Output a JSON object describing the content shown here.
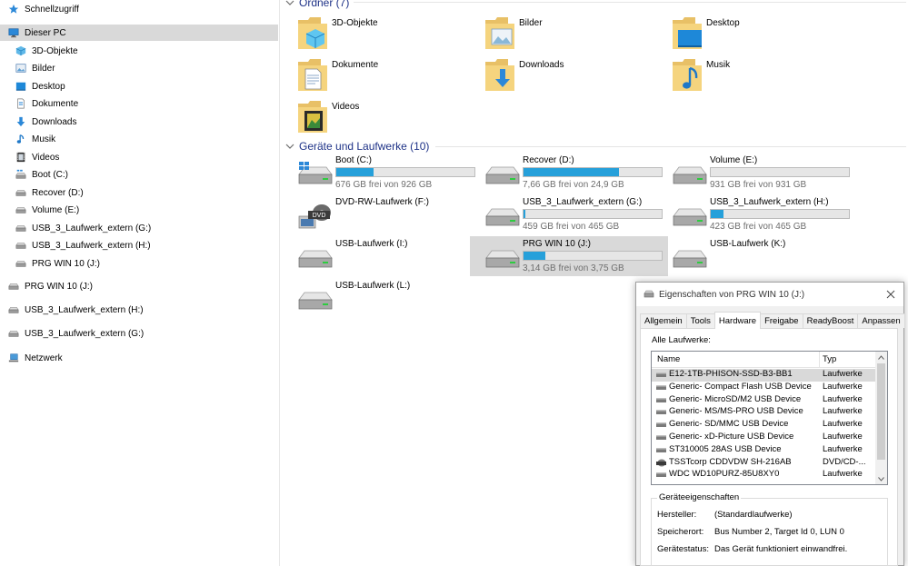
{
  "sidebar": {
    "items": [
      {
        "label": "Schnellzugriff",
        "icon": "star-icon"
      },
      {
        "label": "Dieser PC",
        "icon": "computer-icon"
      },
      {
        "label": "3D-Objekte",
        "icon": "3d-objects-icon"
      },
      {
        "label": "Bilder",
        "icon": "pictures-icon"
      },
      {
        "label": "Desktop",
        "icon": "desktop-icon"
      },
      {
        "label": "Dokumente",
        "icon": "documents-icon"
      },
      {
        "label": "Downloads",
        "icon": "downloads-icon"
      },
      {
        "label": "Musik",
        "icon": "music-icon"
      },
      {
        "label": "Videos",
        "icon": "videos-icon"
      },
      {
        "label": "Boot (C:)",
        "icon": "windows-drive-icon"
      },
      {
        "label": "Recover (D:)",
        "icon": "drive-icon"
      },
      {
        "label": "Volume (E:)",
        "icon": "drive-icon"
      },
      {
        "label": "USB_3_Laufwerk_extern (G:)",
        "icon": "drive-icon"
      },
      {
        "label": "USB_3_Laufwerk_extern  (H:)",
        "icon": "drive-icon"
      },
      {
        "label": "PRG WIN 10 (J:)",
        "icon": "drive-icon"
      },
      {
        "label": "PRG WIN 10 (J:)",
        "icon": "drive-icon"
      },
      {
        "label": "USB_3_Laufwerk_extern  (H:)",
        "icon": "drive-icon"
      },
      {
        "label": "USB_3_Laufwerk_extern (G:)",
        "icon": "drive-icon"
      },
      {
        "label": "Netzwerk",
        "icon": "network-icon"
      }
    ]
  },
  "main": {
    "folders_header": "Ordner (7)",
    "folders": [
      {
        "label": "3D-Objekte",
        "icon": "3d-objects-folder-icon"
      },
      {
        "label": "Bilder",
        "icon": "pictures-folder-icon"
      },
      {
        "label": "Desktop",
        "icon": "desktop-folder-icon"
      },
      {
        "label": "Dokumente",
        "icon": "documents-folder-icon"
      },
      {
        "label": "Downloads",
        "icon": "downloads-folder-icon"
      },
      {
        "label": "Musik",
        "icon": "music-folder-icon"
      },
      {
        "label": "Videos",
        "icon": "videos-folder-icon"
      }
    ],
    "drives_header": "Geräte und Laufwerke (10)",
    "drives": [
      {
        "name": "Boot (C:)",
        "free": "676 GB frei von 926 GB",
        "used_fraction": 0.27,
        "icon": "windows-drive-icon"
      },
      {
        "name": "Recover (D:)",
        "free": "7,66 GB frei von 24,9 GB",
        "used_fraction": 0.69,
        "icon": "drive-icon"
      },
      {
        "name": "Volume (E:)",
        "free": "931 GB frei von 931 GB",
        "used_fraction": 0.0,
        "icon": "drive-icon"
      },
      {
        "name": "DVD-RW-Laufwerk (F:)",
        "free": "",
        "used_fraction": null,
        "icon": "dvd-drive-icon"
      },
      {
        "name": "USB_3_Laufwerk_extern (G:)",
        "free": "459 GB frei von 465 GB",
        "used_fraction": 0.013,
        "icon": "drive-icon"
      },
      {
        "name": "USB_3_Laufwerk_extern  (H:)",
        "free": "423 GB frei von 465 GB",
        "used_fraction": 0.09,
        "icon": "drive-icon"
      },
      {
        "name": "USB-Laufwerk (I:)",
        "free": "",
        "used_fraction": null,
        "icon": "usb-drive-icon"
      },
      {
        "name": "PRG WIN 10 (J:)",
        "free": "3,14 GB frei von 3,75 GB",
        "used_fraction": 0.16,
        "icon": "drive-icon",
        "selected": true
      },
      {
        "name": "USB-Laufwerk (K:)",
        "free": "",
        "used_fraction": null,
        "icon": "usb-drive-icon"
      },
      {
        "name": "USB-Laufwerk (L:)",
        "free": "",
        "used_fraction": null,
        "icon": "usb-drive-icon"
      }
    ]
  },
  "dialog": {
    "title": "Eigenschaften von PRG WIN 10 (J:)",
    "tabs": [
      "Allgemein",
      "Tools",
      "Hardware",
      "Freigabe",
      "ReadyBoost",
      "Anpassen"
    ],
    "active_tab": "Hardware",
    "all_drives_label": "Alle Laufwerke:",
    "columns": [
      "Name",
      "Typ"
    ],
    "rows": [
      {
        "name": "E12-1TB-PHISON-SSD-B3-BB1",
        "type": "Laufwerke",
        "selected": true
      },
      {
        "name": "Generic- Compact Flash USB Device",
        "type": "Laufwerke"
      },
      {
        "name": "Generic- MicroSD/M2 USB Device",
        "type": "Laufwerke"
      },
      {
        "name": "Generic- MS/MS-PRO USB Device",
        "type": "Laufwerke"
      },
      {
        "name": "Generic- SD/MMC USB Device",
        "type": "Laufwerke"
      },
      {
        "name": "Generic- xD-Picture USB Device",
        "type": "Laufwerke"
      },
      {
        "name": "ST310005 28AS USB Device",
        "type": "Laufwerke"
      },
      {
        "name": "TSSTcorp CDDVDW SH-216AB",
        "type": "DVD/CD-..."
      },
      {
        "name": "WDC WD10PURZ-85U8XY0",
        "type": "Laufwerke"
      }
    ],
    "properties_legend": "Geräteeigenschaften",
    "properties": [
      {
        "key": "Hersteller:",
        "value": "(Standardlaufwerke)"
      },
      {
        "key": "Speicherort:",
        "value": "Bus Number 2, Target Id 0, LUN 0"
      },
      {
        "key": "Gerätestatus:",
        "value": "Das Gerät funktioniert einwandfrei."
      }
    ]
  },
  "colors": {
    "accent": "#26a0da",
    "header_text": "#1e3287",
    "selection": "#d9d9d9"
  }
}
